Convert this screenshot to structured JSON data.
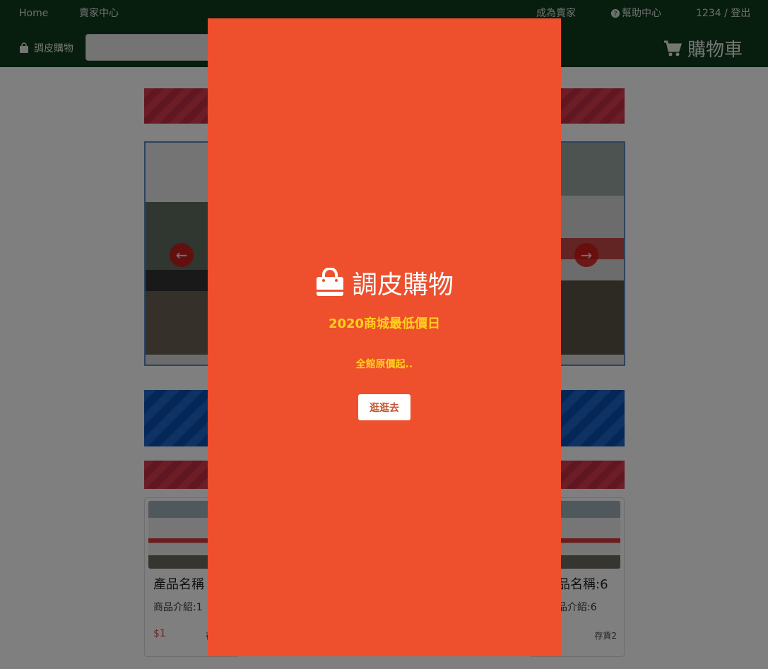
{
  "top_nav": {
    "home": "Home",
    "seller_center": "賣家中心",
    "become_seller": "成為賣家",
    "help_center": "幫助中心",
    "user_logout": "1234 / 登出"
  },
  "header": {
    "brand": "調皮購物",
    "cart": "購物車",
    "search_value": ""
  },
  "products": [
    {
      "name": "產品名稱",
      "desc": "商品介紹:1",
      "price": "$1",
      "stock": "存"
    },
    {
      "name": "品名稱:6",
      "desc": "品介紹:6",
      "price": "",
      "stock": "存貨2"
    }
  ],
  "modal": {
    "brand": "調皮購物",
    "headline": "2020商城最低價日",
    "message": "全館原價起..",
    "button": "逛逛去"
  },
  "colors": {
    "nav_bg": "#0f3a1a",
    "modal_bg": "#ee4f2d",
    "accent_yellow": "#ffd11a",
    "price_red": "#d9534f"
  },
  "icons": {
    "help": "question-circle-icon",
    "brand": "shopping-bag-icon",
    "cart": "shopping-cart-icon",
    "close": "close-icon"
  }
}
